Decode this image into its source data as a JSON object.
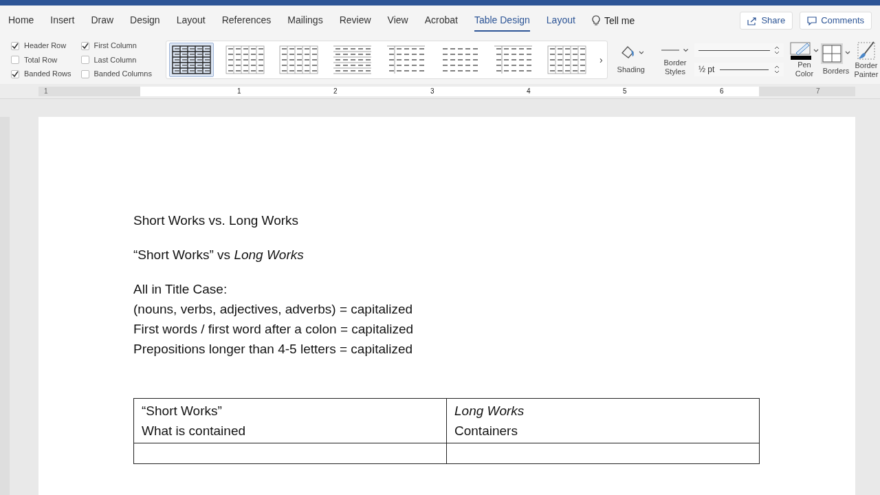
{
  "tabs": [
    {
      "label": "Home",
      "selected": false,
      "contextual": false
    },
    {
      "label": "Insert",
      "selected": false,
      "contextual": false
    },
    {
      "label": "Draw",
      "selected": false,
      "contextual": false
    },
    {
      "label": "Design",
      "selected": false,
      "contextual": false
    },
    {
      "label": "Layout",
      "selected": false,
      "contextual": false
    },
    {
      "label": "References",
      "selected": false,
      "contextual": false
    },
    {
      "label": "Mailings",
      "selected": false,
      "contextual": false
    },
    {
      "label": "Review",
      "selected": false,
      "contextual": false
    },
    {
      "label": "View",
      "selected": false,
      "contextual": false
    },
    {
      "label": "Acrobat",
      "selected": false,
      "contextual": false
    },
    {
      "label": "Table Design",
      "selected": true,
      "contextual": true
    },
    {
      "label": "Layout",
      "selected": false,
      "contextual": true
    }
  ],
  "tell_me": "Tell me",
  "buttons": [
    {
      "kind": "share",
      "label": "Share"
    },
    {
      "kind": "comments",
      "label": "Comments"
    }
  ],
  "ribbon": {
    "options": [
      {
        "label": "Header Row",
        "checked": true
      },
      {
        "label": "Total Row",
        "checked": false
      },
      {
        "label": "Banded Rows",
        "checked": true
      },
      {
        "label": "First Column",
        "checked": true
      },
      {
        "label": "Last Column",
        "checked": false
      },
      {
        "label": "Banded Columns",
        "checked": false
      }
    ],
    "table_styles": [
      {
        "kind": "bold-grid",
        "selected": true
      },
      {
        "kind": "grid",
        "selected": false
      },
      {
        "kind": "grid",
        "selected": false
      },
      {
        "kind": "lines",
        "selected": false
      },
      {
        "kind": "first-column",
        "selected": false
      },
      {
        "kind": "dashes",
        "selected": false
      },
      {
        "kind": "first-column",
        "selected": false
      },
      {
        "kind": "grid",
        "selected": false
      }
    ],
    "more": "›",
    "shading": "Shading",
    "border_styles": "Border Styles",
    "weight": "½ pt",
    "pen_color": "Pen Color",
    "borders": "Borders",
    "border_painter": "Border Painter"
  },
  "ruler": [
    {
      "label": "1",
      "margin": true
    },
    {
      "label": "1",
      "margin": false
    },
    {
      "label": "2",
      "margin": false
    },
    {
      "label": "3",
      "margin": false
    },
    {
      "label": "4",
      "margin": false
    },
    {
      "label": "5",
      "margin": false
    },
    {
      "label": "6",
      "margin": false
    },
    {
      "label": "7",
      "margin": true
    }
  ],
  "document": {
    "blocks": [
      [
        "Short Works vs. Long Works"
      ],
      [
        "“Short Works” vs *Long Works*"
      ],
      [
        "All in Title Case:",
        "(nouns, verbs, adjectives, adverbs) = capitalized",
        "First words / first word after a colon = capitalized",
        "Prepositions longer than 4-5 letters = capitalized"
      ]
    ],
    "table": [
      [
        [
          {
            "text": "“Short Works”",
            "italic": false
          },
          {
            "text": "What is contained",
            "italic": false
          }
        ],
        [
          {
            "text": "Long Works",
            "italic": true
          },
          {
            "text": "Containers",
            "italic": false
          }
        ]
      ]
    ]
  }
}
